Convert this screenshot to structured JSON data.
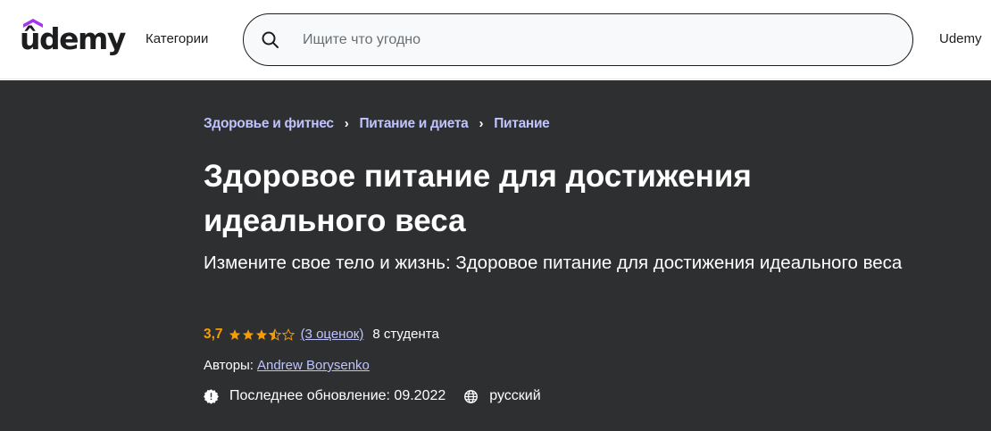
{
  "header": {
    "logo_text": "ûdemy",
    "categories_label": "Категории",
    "search": {
      "placeholder": "Ищите что угодно",
      "value": ""
    },
    "business_label": "Udemy"
  },
  "breadcrumb": [
    "Здоровье и фитнес",
    "Питание и диета",
    "Питание"
  ],
  "course": {
    "title": "Здоровое питание для достижения идеального веса",
    "subtitle": "Измените свое тело и жизнь: Здоровое питание для достижения идеального веса",
    "rating": "3,7",
    "rating_value": 3.7,
    "ratings_link": "(3 оценок)",
    "students": "8 студента",
    "authors_label": "Авторы:",
    "author": "Andrew Borysenko",
    "last_updated": "Последнее обновление: 09.2022",
    "language": "русский"
  },
  "colors": {
    "brand_purple": "#a435f0",
    "hero_bg": "#2d2f31",
    "link": "#c0c4fc",
    "rating": "#f69c08"
  },
  "icons": {
    "search": "search-icon",
    "update": "update-badge-icon",
    "language": "globe-icon",
    "stars": [
      "star-full",
      "star-full",
      "star-full",
      "star-half",
      "star-empty"
    ]
  }
}
